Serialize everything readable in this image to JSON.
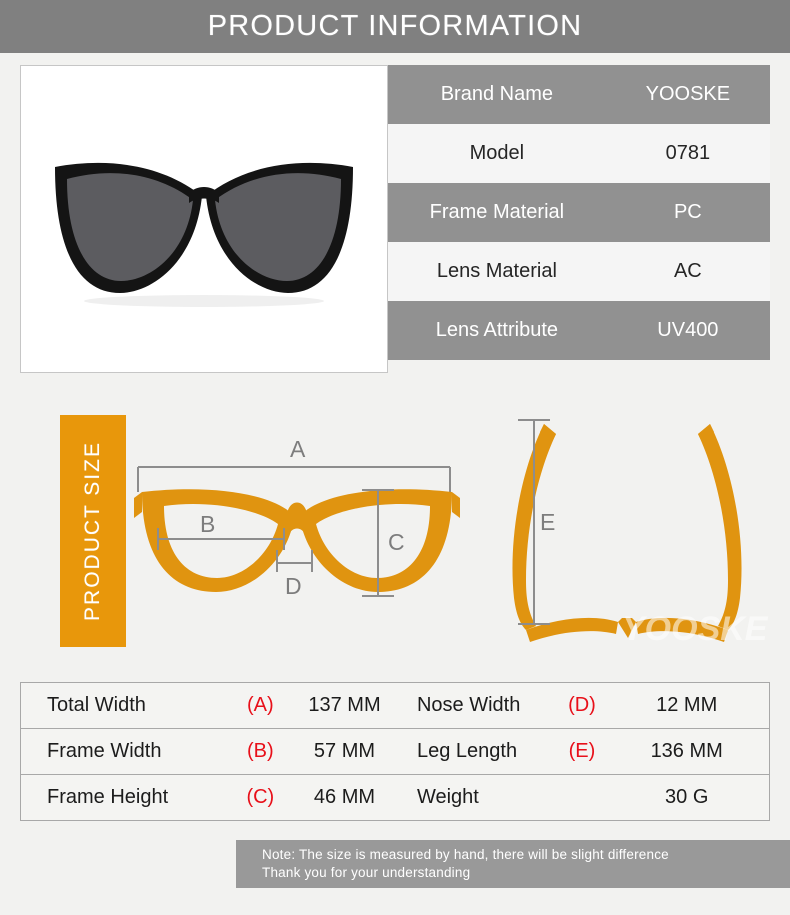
{
  "header": {
    "title": "PRODUCT INFORMATION"
  },
  "product_photo": {
    "alt": "black cat-eye sunglasses front view",
    "frame_color": "#141414",
    "lens_color": "#58585c"
  },
  "spec_table": {
    "rows": [
      {
        "label": "Brand Name",
        "value": "YOOSKE",
        "style": "dark"
      },
      {
        "label": "Model",
        "value": "0781",
        "style": "light"
      },
      {
        "label": "Frame Material",
        "value": "PC",
        "style": "dark"
      },
      {
        "label": "Lens Material",
        "value": "AC",
        "style": "light"
      },
      {
        "label": "Lens Attribute",
        "value": "UV400",
        "style": "dark"
      }
    ]
  },
  "size_section": {
    "banner_label": "PRODUCT SIZE",
    "banner_color": "#e8970b",
    "diagram_color": "#e09410",
    "watermark": "YOOSKE",
    "front_view_markers": [
      "A",
      "B",
      "C",
      "D"
    ],
    "side_view_markers": [
      "E"
    ]
  },
  "dimension_table": {
    "rows": [
      {
        "left_name": "Total Width",
        "left_key": "(A)",
        "left_value": "137 MM",
        "right_name": "Nose Width",
        "right_key": "(D)",
        "right_value": "12 MM"
      },
      {
        "left_name": "Frame Width",
        "left_key": "(B)",
        "left_value": "57  MM",
        "right_name": "Leg Length",
        "right_key": "(E)",
        "right_value": "136 MM"
      },
      {
        "left_name": "Frame Height",
        "left_key": "(C)",
        "left_value": "46  MM",
        "right_name": "Weight",
        "right_key": "",
        "right_value": "30 G"
      }
    ],
    "key_color": "#e8101a"
  },
  "note": {
    "line1": "Note: The size is measured by hand, there will be slight difference",
    "line2": "Thank you for your understanding"
  }
}
